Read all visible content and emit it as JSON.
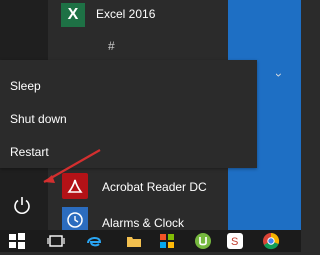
{
  "start_menu": {
    "apps": [
      {
        "name": "Excel 2016",
        "icon": "excel-icon"
      },
      {
        "name": "Acrobat Reader DC",
        "icon": "acrobat-icon"
      },
      {
        "name": "Alarms & Clock",
        "icon": "alarm-clock-icon"
      }
    ],
    "group_header": "#",
    "expand_glyph": "chevron-down-icon"
  },
  "power_menu": {
    "items": [
      "Sleep",
      "Shut down",
      "Restart"
    ]
  },
  "taskbar": {
    "icons": [
      "start-icon",
      "task-view-icon",
      "edge-icon",
      "folder-icon",
      "store-icon",
      "utorrent-icon",
      "snagit-icon",
      "chrome-icon"
    ]
  },
  "colors": {
    "menu_bg": "#2b2b2b",
    "rail_bg": "#1f1f1f",
    "accent_blue": "#1e6fc4",
    "annotation_red": "#d32f2f"
  }
}
